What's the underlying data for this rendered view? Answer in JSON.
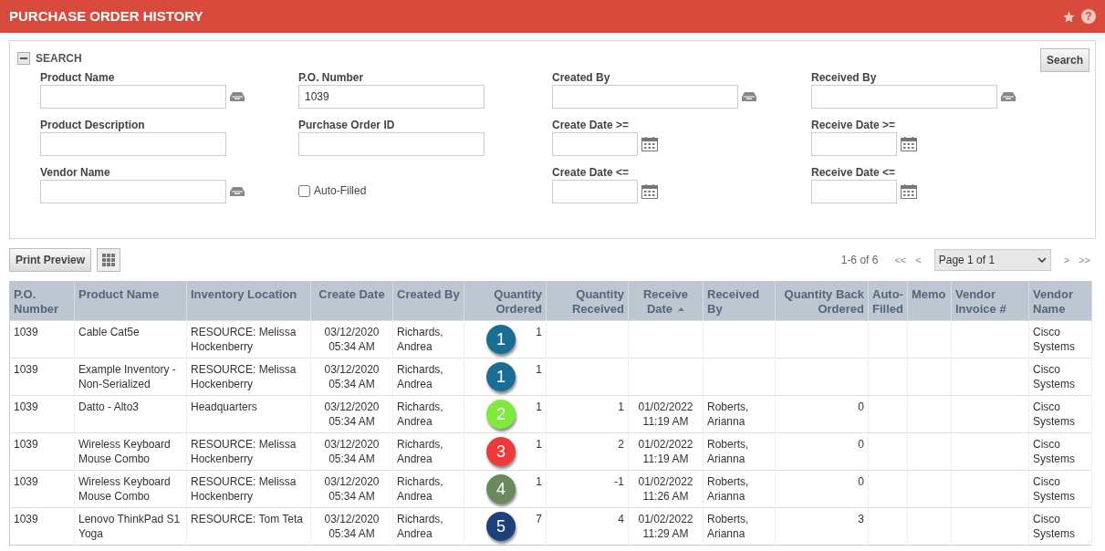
{
  "header": {
    "title": "PURCHASE ORDER HISTORY",
    "help": "?"
  },
  "search": {
    "title": "SEARCH",
    "expanded": true,
    "button": "Search",
    "fields": [
      {
        "label": "Product Name",
        "kind": "lookup"
      },
      {
        "label": "P.O. Number",
        "value": "1039",
        "kind": "text"
      },
      {
        "label": "Created By",
        "kind": "lookup"
      },
      {
        "label": "Received By",
        "kind": "lookup"
      },
      {
        "label": "Product Description",
        "kind": "text"
      },
      {
        "label": "Purchase Order ID",
        "kind": "text"
      },
      {
        "label": "Create Date >=",
        "kind": "date"
      },
      {
        "label": "Receive Date >=",
        "kind": "date"
      },
      {
        "label": "Vendor Name",
        "kind": "lookup"
      },
      {
        "label": "Auto-Filled",
        "checked": false,
        "kind": "checkbox"
      },
      {
        "label": "Create Date <=",
        "kind": "date"
      },
      {
        "label": "Receive Date <=",
        "kind": "date"
      }
    ]
  },
  "toolbar": {
    "print_button": "Print Preview",
    "range": "1-6 of 6",
    "first": "<<",
    "prev": "<",
    "page": "Page 1 of 1",
    "next": ">",
    "last": ">>"
  },
  "table": {
    "columns": [
      {
        "label": "P.O. Number",
        "sorted": false
      },
      {
        "label": "Product Name",
        "sorted": false
      },
      {
        "label": "Inventory Location",
        "sorted": false
      },
      {
        "label": "Create Date",
        "sorted": false
      },
      {
        "label": "Created By",
        "sorted": false
      },
      {
        "label": "Quantity Ordered",
        "sorted": false
      },
      {
        "label": "Quantity Received",
        "sorted": false
      },
      {
        "label": "Receive Date",
        "sorted": true
      },
      {
        "label": "Received By",
        "sorted": false
      },
      {
        "label": "Quantity Back Ordered",
        "sorted": false
      },
      {
        "label": "Auto-Filled",
        "sorted": false
      },
      {
        "label": "Memo",
        "sorted": false
      },
      {
        "label": "Vendor Invoice #",
        "sorted": false
      },
      {
        "label": "Vendor Name",
        "sorted": false
      }
    ],
    "rows": [
      {
        "badge": "1",
        "color": "#1a6e96",
        "cells": [
          "1039",
          "Cable Cat5e",
          "RESOURCE: Melissa Hockenberry",
          "03/12/2020 05:34 AM",
          "Richards, Andrea",
          "1",
          "",
          "",
          "",
          "",
          "",
          "",
          "",
          "Cisco Systems"
        ]
      },
      {
        "badge": "1",
        "color": "#1a6e96",
        "cells": [
          "1039",
          "Example Inventory - Non-Serialized",
          "RESOURCE: Melissa Hockenberry",
          "03/12/2020 05:34 AM",
          "Richards, Andrea",
          "1",
          "",
          "",
          "",
          "",
          "",
          "",
          "",
          "Cisco Systems"
        ]
      },
      {
        "badge": "2",
        "color": "#80ea3c",
        "cells": [
          "1039",
          "Datto - Alto3",
          "Headquarters",
          "03/12/2020 05:34 AM",
          "Richards, Andrea",
          "1",
          "1",
          "01/02/2022 11:19 AM",
          "Roberts, Arianna",
          "0",
          "",
          "",
          "",
          "Cisco Systems"
        ]
      },
      {
        "badge": "3",
        "color": "#ef3a3a",
        "cells": [
          "1039",
          "Wireless Keyboard Mouse Combo",
          "RESOURCE: Melissa Hockenberry",
          "03/12/2020 05:34 AM",
          "Richards, Andrea",
          "1",
          "2",
          "01/02/2022 11:19 AM",
          "Roberts, Arianna",
          "0",
          "",
          "",
          "",
          "Cisco Systems"
        ]
      },
      {
        "badge": "4",
        "color": "#6b8a5c",
        "cells": [
          "1039",
          "Wireless Keyboard Mouse Combo",
          "RESOURCE: Melissa Hockenberry",
          "03/12/2020 05:34 AM",
          "Richards, Andrea",
          "1",
          "-1",
          "01/02/2022 11:26 AM",
          "Roberts, Arianna",
          "0",
          "",
          "",
          "",
          "Cisco Systems"
        ]
      },
      {
        "badge": "5",
        "color": "#1d3f7a",
        "cells": [
          "1039",
          "Lenovo ThinkPad S1 Yoga",
          "RESOURCE: Tom Teta",
          "03/12/2020 05:34 AM",
          "Richards, Andrea",
          "7",
          "4",
          "01/02/2022 11:29 AM",
          "Roberts, Arianna",
          "3",
          "",
          "",
          "",
          "Cisco Systems"
        ]
      }
    ]
  }
}
